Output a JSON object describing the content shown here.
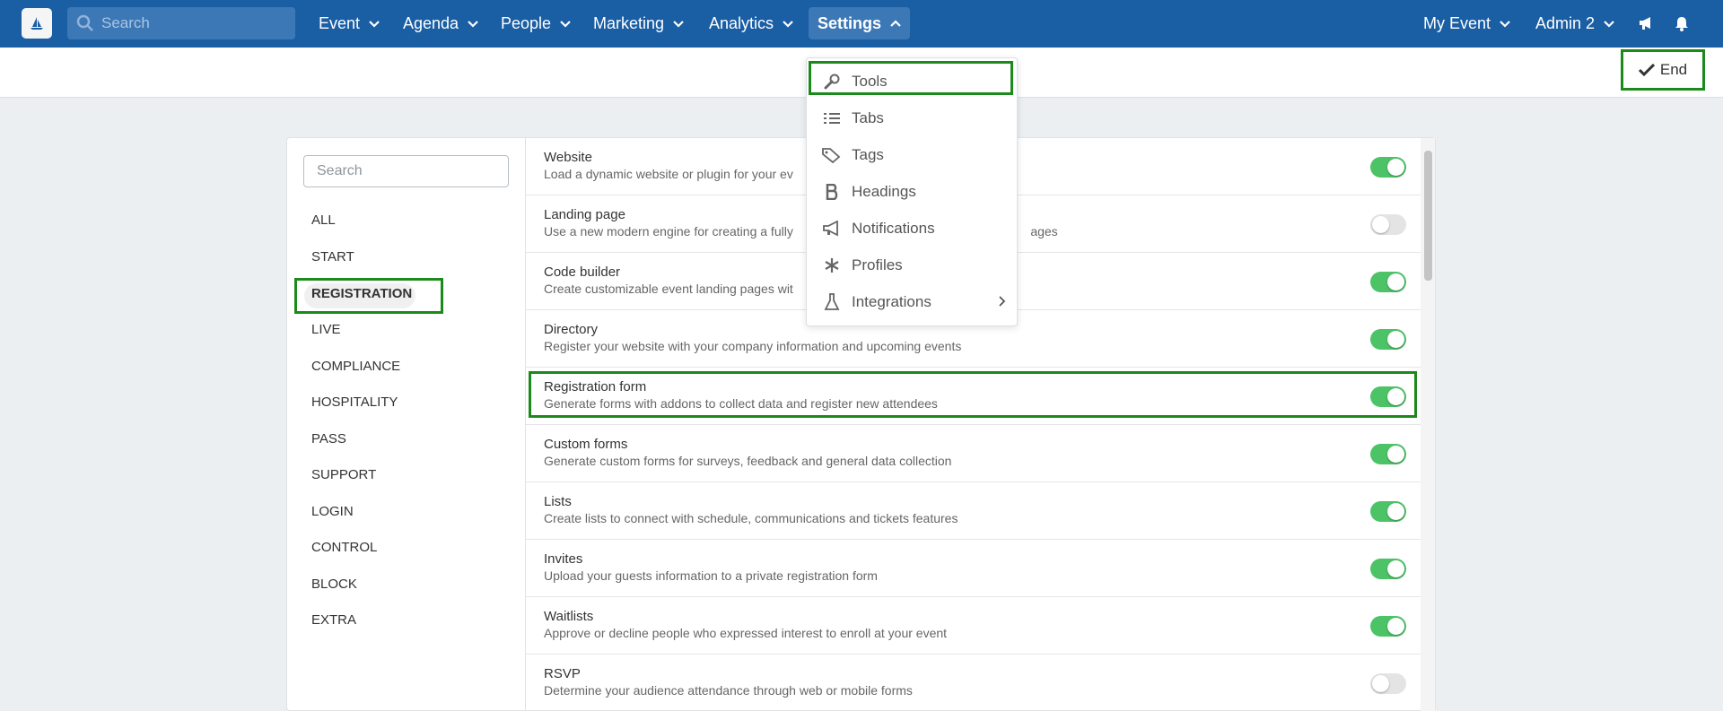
{
  "nav": {
    "search_placeholder": "Search",
    "items": [
      {
        "label": "Event"
      },
      {
        "label": "Agenda"
      },
      {
        "label": "People"
      },
      {
        "label": "Marketing"
      },
      {
        "label": "Analytics"
      },
      {
        "label": "Settings"
      }
    ],
    "my_event": "My Event",
    "admin": "Admin 2"
  },
  "subheader": {
    "end_label": "End"
  },
  "sidebar": {
    "search_placeholder": "Search",
    "categories": [
      "ALL",
      "START",
      "REGISTRATION",
      "LIVE",
      "COMPLIANCE",
      "HOSPITALITY",
      "PASS",
      "SUPPORT",
      "LOGIN",
      "CONTROL",
      "BLOCK",
      "EXTRA"
    ],
    "active": "REGISTRATION"
  },
  "features": [
    {
      "title": "Website",
      "desc": "Load a dynamic website or plugin for your ev",
      "on": true
    },
    {
      "title": "Landing page",
      "desc": "Use a new modern engine for creating a fully                                                                    ages",
      "on": false
    },
    {
      "title": "Code builder",
      "desc": "Create customizable event landing pages wit",
      "on": true
    },
    {
      "title": "Directory",
      "desc": "Register your website with your company information and upcoming events",
      "on": true
    },
    {
      "title": "Registration form",
      "desc": "Generate forms with addons to collect data and register new attendees",
      "on": true
    },
    {
      "title": "Custom forms",
      "desc": "Generate custom forms for surveys, feedback and general data collection",
      "on": true
    },
    {
      "title": "Lists",
      "desc": "Create lists to connect with schedule, communications and tickets features",
      "on": true
    },
    {
      "title": "Invites",
      "desc": "Upload your guests information to a private registration form",
      "on": true
    },
    {
      "title": "Waitlists",
      "desc": "Approve or decline people who expressed interest to enroll at your event",
      "on": true
    },
    {
      "title": "RSVP",
      "desc": "Determine your audience attendance through web or mobile forms",
      "on": false
    }
  ],
  "settings_menu": {
    "items": [
      {
        "label": "Tools",
        "icon": "wrench-icon"
      },
      {
        "label": "Tabs",
        "icon": "list-icon"
      },
      {
        "label": "Tags",
        "icon": "tags-icon"
      },
      {
        "label": "Headings",
        "icon": "bold-icon"
      },
      {
        "label": "Notifications",
        "icon": "megaphone-icon"
      },
      {
        "label": "Profiles",
        "icon": "asterisk-icon"
      },
      {
        "label": "Integrations",
        "icon": "flask-icon"
      }
    ]
  },
  "colors": {
    "nav": "#1a5ea4",
    "toggle_on": "#4cc366",
    "highlight": "#1b8a1b"
  }
}
